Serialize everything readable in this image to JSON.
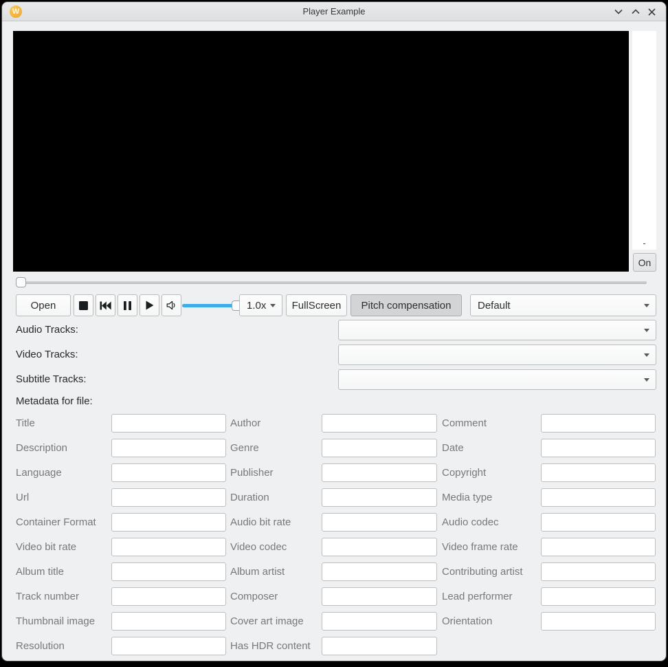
{
  "colors": {
    "accent": "#3daee9",
    "window_bg": "#eff0f1",
    "titlebar_bg": "#e3e5e6",
    "pressed_button_bg": "#d2d4d5",
    "logo_bg": "#f0a830"
  },
  "titlebar": {
    "title": "Player Example",
    "logo_letter": "W",
    "icons": [
      "logo-icon",
      "shade-chevron-down-icon",
      "maximize-chevron-up-icon",
      "close-x-icon"
    ]
  },
  "player": {
    "side_minus_label": "-",
    "on_button": "On"
  },
  "controls": {
    "open": "Open",
    "icons": [
      "stop-icon",
      "skip-backward-icon",
      "pause-icon",
      "play-icon",
      "volume-icon"
    ],
    "speed_selected": "1.0x",
    "fullscreen": "FullScreen",
    "pitch_compensation": "Pitch compensation",
    "audio_output_selected": "Default",
    "volume_level": "full",
    "seek_position": "start"
  },
  "tracks": [
    {
      "label": "Audio Tracks:",
      "selected": ""
    },
    {
      "label": "Video Tracks:",
      "selected": ""
    },
    {
      "label": "Subtitle Tracks:",
      "selected": ""
    }
  ],
  "metadata": {
    "heading": "Metadata for file:",
    "rows": [
      [
        "Title",
        "Author",
        "Comment"
      ],
      [
        "Description",
        "Genre",
        "Date"
      ],
      [
        "Language",
        "Publisher",
        "Copyright"
      ],
      [
        "Url",
        "Duration",
        "Media type"
      ],
      [
        "Container Format",
        "Audio bit rate",
        "Audio codec"
      ],
      [
        "Video bit rate",
        "Video codec",
        "Video frame rate"
      ],
      [
        "Album title",
        "Album artist",
        "Contributing artist"
      ],
      [
        "Track number",
        "Composer",
        "Lead performer"
      ],
      [
        "Thumbnail image",
        "Cover art image",
        "Orientation"
      ],
      [
        "Resolution",
        "Has HDR content",
        null
      ]
    ],
    "field_values": ""
  }
}
